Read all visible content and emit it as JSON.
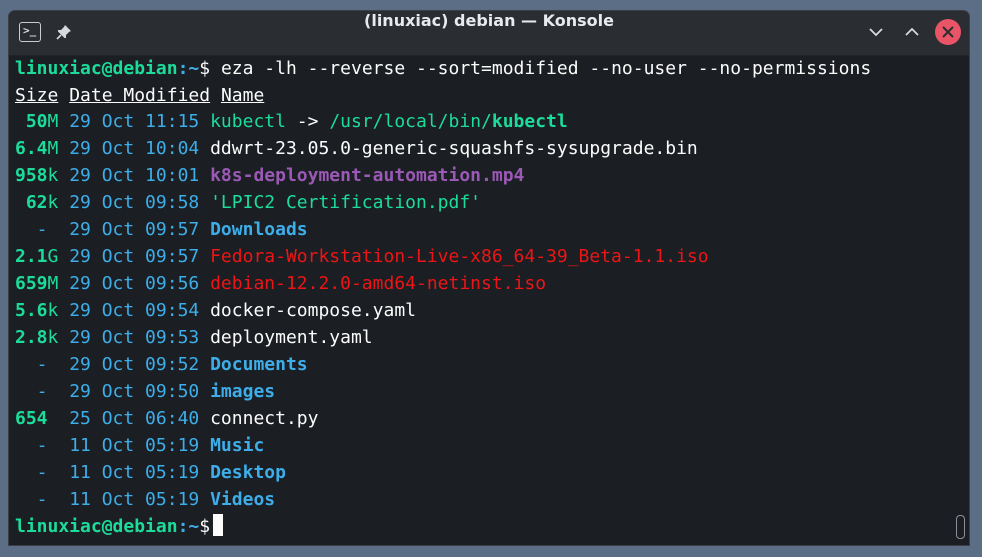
{
  "window": {
    "title": "(linuxiac) debian — Konsole"
  },
  "titlebar": {
    "app_icon_glyph": ">_",
    "buttons": [
      "pin",
      "minimize",
      "maximize",
      "close"
    ]
  },
  "terminal": {
    "prompt_user": "linuxiac@debian",
    "prompt_path": ":~",
    "prompt_symbol": "$ ",
    "command": "eza -lh --reverse --sort=modified --no-user --no-permissions",
    "headers": {
      "size": "Size",
      "date": "Date Modified",
      "name": "Name"
    },
    "rows": [
      {
        "size_num": " 50",
        "size_unit": "M",
        "date": "29 Oct 11:15",
        "name": "kubectl",
        "kind": "link",
        "arrow": " -> ",
        "target_dir": "/usr/local/bin/",
        "target_file": "kubectl"
      },
      {
        "size_num": "6.4",
        "size_unit": "M",
        "date": "29 Oct 10:04",
        "name": "ddwrt-23.05.0-generic-squashfs-sysupgrade.bin",
        "kind": "file"
      },
      {
        "size_num": "958",
        "size_unit": "k",
        "date": "29 Oct 10:01",
        "name": "k8s-deployment-automation.mp4",
        "kind": "video"
      },
      {
        "size_num": " 62",
        "size_unit": "k",
        "date": "29 Oct 09:58",
        "name": "'LPIC2 Certification.pdf'",
        "kind": "doc"
      },
      {
        "size_num": "  -",
        "size_unit": "",
        "date": "29 Oct 09:57",
        "name": "Downloads",
        "kind": "dir"
      },
      {
        "size_num": "2.1",
        "size_unit": "G",
        "date": "29 Oct 09:57",
        "name": "Fedora-Workstation-Live-x86_64-39_Beta-1.1.iso",
        "kind": "archive"
      },
      {
        "size_num": "659",
        "size_unit": "M",
        "date": "29 Oct 09:56",
        "name": "debian-12.2.0-amd64-netinst.iso",
        "kind": "archive"
      },
      {
        "size_num": "5.6",
        "size_unit": "k",
        "date": "29 Oct 09:54",
        "name": "docker-compose.yaml",
        "kind": "file"
      },
      {
        "size_num": "2.8",
        "size_unit": "k",
        "date": "29 Oct 09:53",
        "name": "deployment.yaml",
        "kind": "file"
      },
      {
        "size_num": "  -",
        "size_unit": "",
        "date": "29 Oct 09:52",
        "name": "Documents",
        "kind": "dir"
      },
      {
        "size_num": "  -",
        "size_unit": "",
        "date": "29 Oct 09:50",
        "name": "images",
        "kind": "dir"
      },
      {
        "size_num": "654",
        "size_unit": "",
        "date": "25 Oct 06:40",
        "name": "connect.py",
        "kind": "file"
      },
      {
        "size_num": "  -",
        "size_unit": "",
        "date": "11 Oct 05:19",
        "name": "Music",
        "kind": "dir"
      },
      {
        "size_num": "  -",
        "size_unit": "",
        "date": "11 Oct 05:19",
        "name": "Desktop",
        "kind": "dir"
      },
      {
        "size_num": "  -",
        "size_unit": "",
        "date": "11 Oct 05:19",
        "name": "Videos",
        "kind": "dir"
      }
    ]
  },
  "colors": {
    "background": "#1b1e23",
    "prompt_user": "#1cdc9a",
    "prompt_path": "#3daee9",
    "directory": "#3daee9",
    "video": "#9b59b6",
    "archive": "#ed1515",
    "close_button": "#e95467"
  }
}
